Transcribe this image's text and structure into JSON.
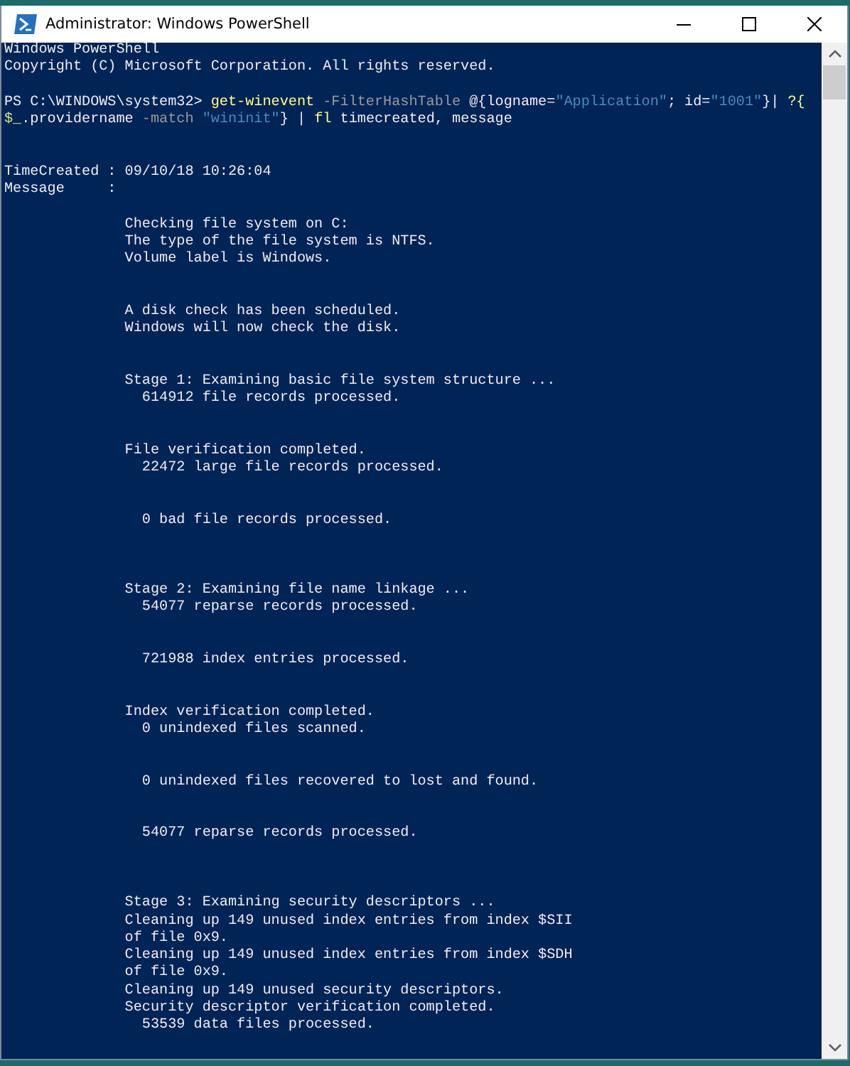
{
  "window": {
    "title": "Administrator: Windows PowerShell"
  },
  "console": {
    "lines": [
      {
        "kind": "text",
        "segments": [
          {
            "kind": "plain",
            "text": "Windows PowerShell"
          }
        ]
      },
      {
        "kind": "text",
        "segments": [
          {
            "kind": "plain",
            "text": "Copyright (C) Microsoft Corporation. All rights reserved."
          }
        ]
      },
      {
        "kind": "blank"
      },
      {
        "kind": "text",
        "segments": [
          {
            "kind": "plain",
            "text": "PS C:\\WINDOWS\\system32> "
          },
          {
            "kind": "command",
            "text": "get-winevent"
          },
          {
            "kind": "param",
            "text": " -FilterHashTable"
          },
          {
            "kind": "plain",
            "text": " @{logname="
          },
          {
            "kind": "string",
            "text": "\"Application\""
          },
          {
            "kind": "plain",
            "text": "; id="
          },
          {
            "kind": "string",
            "text": "\"1001\""
          },
          {
            "kind": "plain",
            "text": "}| "
          },
          {
            "kind": "command",
            "text": "?{"
          }
        ]
      },
      {
        "kind": "text",
        "segments": [
          {
            "kind": "variable",
            "text": "$_"
          },
          {
            "kind": "plain",
            "text": ".providername"
          },
          {
            "kind": "param",
            "text": " -match"
          },
          {
            "kind": "string",
            "text": " \"wininit\""
          },
          {
            "kind": "plain",
            "text": "} | "
          },
          {
            "kind": "command",
            "text": "fl"
          },
          {
            "kind": "plain",
            "text": " timecreated, message"
          }
        ]
      },
      {
        "kind": "blank"
      },
      {
        "kind": "blank"
      },
      {
        "kind": "text",
        "segments": [
          {
            "kind": "plain",
            "text": "TimeCreated : 09/10/18 10:26:04"
          }
        ]
      },
      {
        "kind": "text",
        "segments": [
          {
            "kind": "plain",
            "text": "Message     :"
          }
        ]
      },
      {
        "kind": "blank"
      },
      {
        "kind": "text",
        "segments": [
          {
            "kind": "plain",
            "text": "              Checking file system on C:"
          }
        ]
      },
      {
        "kind": "text",
        "segments": [
          {
            "kind": "plain",
            "text": "              The type of the file system is NTFS."
          }
        ]
      },
      {
        "kind": "text",
        "segments": [
          {
            "kind": "plain",
            "text": "              Volume label is Windows."
          }
        ]
      },
      {
        "kind": "blank"
      },
      {
        "kind": "blank"
      },
      {
        "kind": "text",
        "segments": [
          {
            "kind": "plain",
            "text": "              A disk check has been scheduled."
          }
        ]
      },
      {
        "kind": "text",
        "segments": [
          {
            "kind": "plain",
            "text": "              Windows will now check the disk."
          }
        ]
      },
      {
        "kind": "blank"
      },
      {
        "kind": "blank"
      },
      {
        "kind": "text",
        "segments": [
          {
            "kind": "plain",
            "text": "              Stage 1: Examining basic file system structure ..."
          }
        ]
      },
      {
        "kind": "text",
        "segments": [
          {
            "kind": "plain",
            "text": "                614912 file records processed."
          }
        ]
      },
      {
        "kind": "blank"
      },
      {
        "kind": "blank"
      },
      {
        "kind": "text",
        "segments": [
          {
            "kind": "plain",
            "text": "              File verification completed."
          }
        ]
      },
      {
        "kind": "text",
        "segments": [
          {
            "kind": "plain",
            "text": "                22472 large file records processed."
          }
        ]
      },
      {
        "kind": "blank"
      },
      {
        "kind": "blank"
      },
      {
        "kind": "text",
        "segments": [
          {
            "kind": "plain",
            "text": "                0 bad file records processed."
          }
        ]
      },
      {
        "kind": "blank"
      },
      {
        "kind": "blank"
      },
      {
        "kind": "blank"
      },
      {
        "kind": "text",
        "segments": [
          {
            "kind": "plain",
            "text": "              Stage 2: Examining file name linkage ..."
          }
        ]
      },
      {
        "kind": "text",
        "segments": [
          {
            "kind": "plain",
            "text": "                54077 reparse records processed."
          }
        ]
      },
      {
        "kind": "blank"
      },
      {
        "kind": "blank"
      },
      {
        "kind": "text",
        "segments": [
          {
            "kind": "plain",
            "text": "                721988 index entries processed."
          }
        ]
      },
      {
        "kind": "blank"
      },
      {
        "kind": "blank"
      },
      {
        "kind": "text",
        "segments": [
          {
            "kind": "plain",
            "text": "              Index verification completed."
          }
        ]
      },
      {
        "kind": "text",
        "segments": [
          {
            "kind": "plain",
            "text": "                0 unindexed files scanned."
          }
        ]
      },
      {
        "kind": "blank"
      },
      {
        "kind": "blank"
      },
      {
        "kind": "text",
        "segments": [
          {
            "kind": "plain",
            "text": "                0 unindexed files recovered to lost and found."
          }
        ]
      },
      {
        "kind": "blank"
      },
      {
        "kind": "blank"
      },
      {
        "kind": "text",
        "segments": [
          {
            "kind": "plain",
            "text": "                54077 reparse records processed."
          }
        ]
      },
      {
        "kind": "blank"
      },
      {
        "kind": "blank"
      },
      {
        "kind": "blank"
      },
      {
        "kind": "text",
        "segments": [
          {
            "kind": "plain",
            "text": "              Stage 3: Examining security descriptors ..."
          }
        ]
      },
      {
        "kind": "text",
        "segments": [
          {
            "kind": "plain",
            "text": "              Cleaning up 149 unused index entries from index $SII"
          }
        ]
      },
      {
        "kind": "text",
        "segments": [
          {
            "kind": "plain",
            "text": "              of file 0x9."
          }
        ]
      },
      {
        "kind": "text",
        "segments": [
          {
            "kind": "plain",
            "text": "              Cleaning up 149 unused index entries from index $SDH"
          }
        ]
      },
      {
        "kind": "text",
        "segments": [
          {
            "kind": "plain",
            "text": "              of file 0x9."
          }
        ]
      },
      {
        "kind": "text",
        "segments": [
          {
            "kind": "plain",
            "text": "              Cleaning up 149 unused security descriptors."
          }
        ]
      },
      {
        "kind": "text",
        "segments": [
          {
            "kind": "plain",
            "text": "              Security descriptor verification completed."
          }
        ]
      },
      {
        "kind": "text",
        "segments": [
          {
            "kind": "plain",
            "text": "                53539 data files processed."
          }
        ]
      }
    ]
  }
}
